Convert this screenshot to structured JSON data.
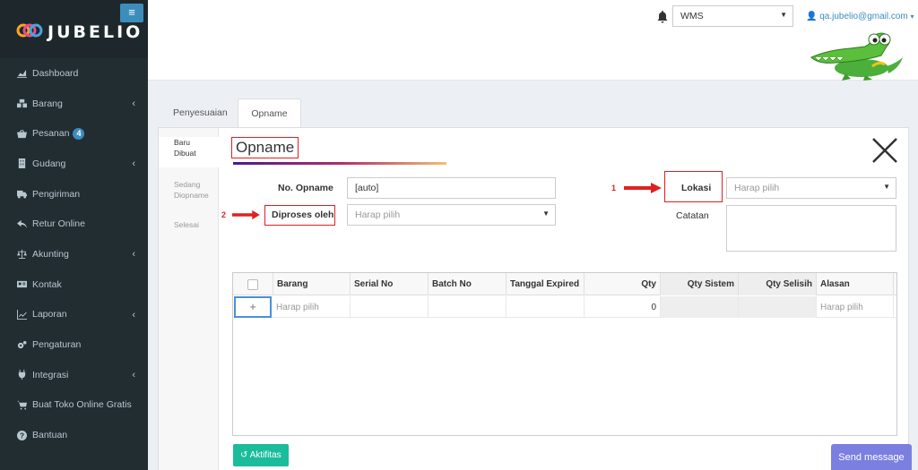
{
  "brand": {
    "name": "JUBELIO"
  },
  "sidebar": {
    "toggle_icon": "hamburger-icon",
    "items": [
      {
        "label": "Dashboard",
        "icon": "chart-area-icon",
        "has_chevron": false
      },
      {
        "label": "Barang",
        "icon": "cubes-icon",
        "has_chevron": true
      },
      {
        "label": "Pesanan",
        "icon": "basket-icon",
        "has_chevron": false,
        "badge": "4"
      },
      {
        "label": "Gudang",
        "icon": "building-icon",
        "has_chevron": true
      },
      {
        "label": "Pengiriman",
        "icon": "truck-icon",
        "has_chevron": false
      },
      {
        "label": "Retur Online",
        "icon": "reply-icon",
        "has_chevron": false
      },
      {
        "label": "Akunting",
        "icon": "balance-scale-icon",
        "has_chevron": true
      },
      {
        "label": "Kontak",
        "icon": "address-card-icon",
        "has_chevron": false
      },
      {
        "label": "Laporan",
        "icon": "line-chart-icon",
        "has_chevron": true
      },
      {
        "label": "Pengaturan",
        "icon": "cogs-icon",
        "has_chevron": false
      },
      {
        "label": "Integrasi",
        "icon": "plug-icon",
        "has_chevron": true
      },
      {
        "label": "Buat Toko Online Gratis",
        "icon": "cart-icon",
        "has_chevron": false
      },
      {
        "label": "Bantuan",
        "icon": "question-circle-icon",
        "has_chevron": false
      }
    ]
  },
  "header": {
    "warehouse_select": "WMS",
    "user_email": "qa.jubelio@gmail.com"
  },
  "top_tabs": [
    {
      "label": "Penyesuaian",
      "active": false
    },
    {
      "label": "Opname",
      "active": true
    }
  ],
  "side_tabs": [
    {
      "label": "Baru Dibuat",
      "active": true
    },
    {
      "label": "Sedang Diopname",
      "active": false
    },
    {
      "label": "Selesai",
      "active": false
    }
  ],
  "form": {
    "title": "Opname",
    "no_opname_label": "No. Opname",
    "no_opname_value": "[auto]",
    "diproses_label": "Diproses oleh",
    "diproses_placeholder": "Harap pilih",
    "lokasi_label": "Lokasi",
    "lokasi_placeholder": "Harap pilih",
    "catatan_label": "Catatan",
    "annotation_1": "1",
    "annotation_2": "2"
  },
  "grid": {
    "columns": [
      "Barang",
      "Serial No",
      "Batch No",
      "Tanggal Expired",
      "Qty",
      "Qty Sistem",
      "Qty Selisih",
      "Alasan"
    ],
    "rows": [
      {
        "add": "+",
        "barang": "Harap pilih",
        "serial": "",
        "batch": "",
        "expired": "",
        "qty": "0",
        "qty_sistem": "",
        "qty_selisih": "",
        "alasan": "Harap pilih"
      }
    ]
  },
  "buttons": {
    "aktifitas": "Aktifitas",
    "send_message": "Send message"
  },
  "colors": {
    "sidebar_bg": "#222d32",
    "accent_blue": "#3c8dbc",
    "annotation_red": "#e02020",
    "aktifitas_green": "#1abc9c",
    "send_purple": "#7b7fe0"
  }
}
